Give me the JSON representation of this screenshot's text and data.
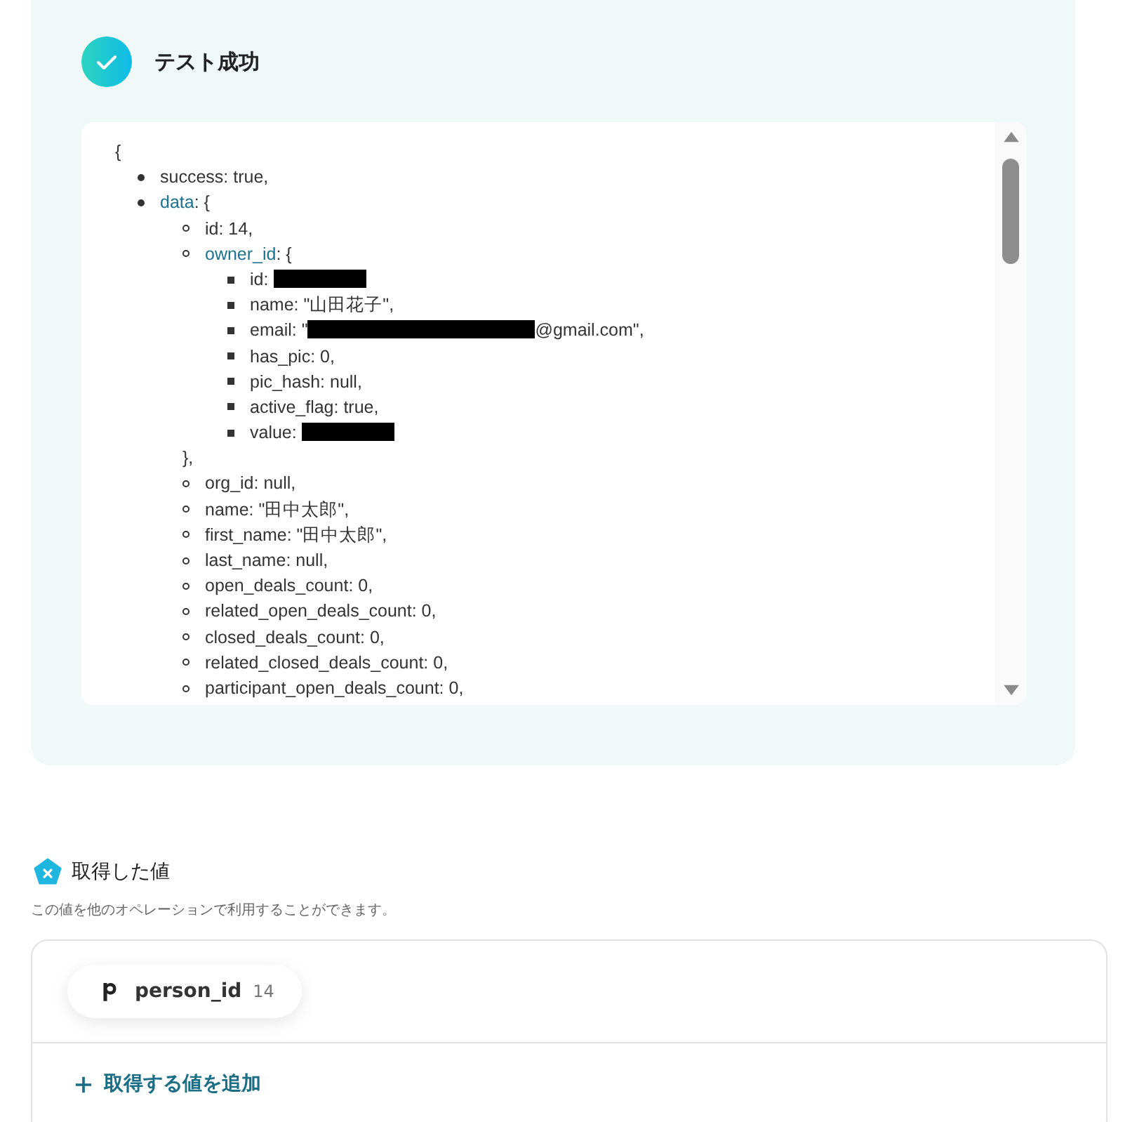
{
  "test_result": {
    "title": "テスト成功",
    "open_brace": "{",
    "lines": [
      {
        "key": "success",
        "value": ": true,"
      },
      {
        "key": "data",
        "link": true,
        "value": ": {",
        "children": [
          {
            "key": "id",
            "value": ": 14,"
          },
          {
            "key": "owner_id",
            "link": true,
            "value": ": {",
            "close": "},",
            "children": [
              {
                "key": "id",
                "value": ": ",
                "redacted": true
              },
              {
                "key": "name",
                "value": ": \"山田花子\","
              },
              {
                "key": "email",
                "value": ": \"",
                "redacted": true,
                "suffix": "@gmail.com\","
              },
              {
                "key": "has_pic",
                "value": ": 0,"
              },
              {
                "key": "pic_hash",
                "value": ": null,"
              },
              {
                "key": "active_flag",
                "value": ": true,"
              },
              {
                "key": "value",
                "value": ": ",
                "redacted": true
              }
            ]
          },
          {
            "key": "org_id",
            "value": ": null,"
          },
          {
            "key": "name",
            "value": ": \"田中太郎\","
          },
          {
            "key": "first_name",
            "value": ": \"田中太郎\","
          },
          {
            "key": "last_name",
            "value": ": null,"
          },
          {
            "key": "open_deals_count",
            "value": ": 0,"
          },
          {
            "key": "related_open_deals_count",
            "value": ": 0,"
          },
          {
            "key": "closed_deals_count",
            "value": ": 0,"
          },
          {
            "key": "related_closed_deals_count",
            "value": ": 0,"
          },
          {
            "key": "participant_open_deals_count",
            "value": ": 0,"
          }
        ]
      }
    ]
  },
  "fetched_values": {
    "title": "取得した値",
    "description": "この値を他のオペレーションで利用することができます。",
    "items": [
      {
        "name": "person_id",
        "value": "14"
      }
    ],
    "add_button": "取得する値を追加"
  }
}
